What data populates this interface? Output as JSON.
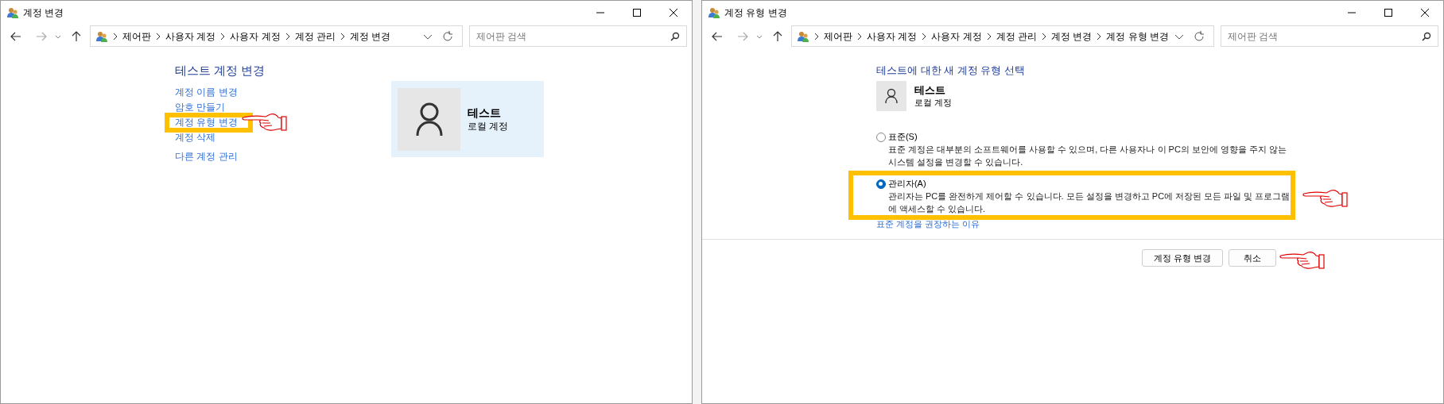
{
  "left_window": {
    "title": "계정 변경",
    "breadcrumb": [
      "제어판",
      "사용자 계정",
      "사용자 계정",
      "계정 관리",
      "계정 변경"
    ],
    "search": {
      "placeholder": "제어판 검색"
    },
    "heading": "테스트 계정 변경",
    "links": [
      {
        "label": "계정 이름 변경",
        "highlighted": false,
        "pointed": false
      },
      {
        "label": "암호 만들기",
        "highlighted": false,
        "pointed": false
      },
      {
        "label": "계정 유형 변경",
        "highlighted": true,
        "pointed": true
      },
      {
        "label": "계정 삭제",
        "highlighted": false,
        "pointed": false
      },
      {
        "label": "다른 계정 관리",
        "highlighted": false,
        "pointed": false
      }
    ],
    "account": {
      "name": "테스트",
      "type": "로컬 계정"
    }
  },
  "right_window": {
    "title": "계정 유형 변경",
    "breadcrumb": [
      "제어판",
      "사용자 계정",
      "사용자 계정",
      "계정 관리",
      "계정 변경",
      "계정 유형 변경"
    ],
    "search": {
      "placeholder": "제어판 검색"
    },
    "heading": "테스트에 대한 새 계정 유형 선택",
    "account": {
      "name": "테스트",
      "type": "로컬 계정"
    },
    "options": [
      {
        "label": "표준(S)",
        "selected": false,
        "highlighted": false,
        "pointed": false,
        "lines": [
          "표준 계정은 대부분의 소프트웨어를 사용할 수 있으며, 다른 사용자나 이 PC의 보안에 영향을 주지 않는",
          "시스템 설정을 변경할 수 있습니다."
        ]
      },
      {
        "label": "관리자(A)",
        "selected": true,
        "highlighted": true,
        "pointed": true,
        "lines": [
          "관리자는 PC를 완전하게 제어할 수 있습니다. 모든 설정을 변경하고 PC에 저장된 모든 파일 및 프로그램",
          "에 액세스할 수 있습니다."
        ]
      }
    ],
    "link": "표준 계정을 권장하는 이유",
    "buttons": [
      {
        "label": "계정 유형 변경",
        "pointed": false
      },
      {
        "label": "취소",
        "pointed": true
      }
    ]
  }
}
